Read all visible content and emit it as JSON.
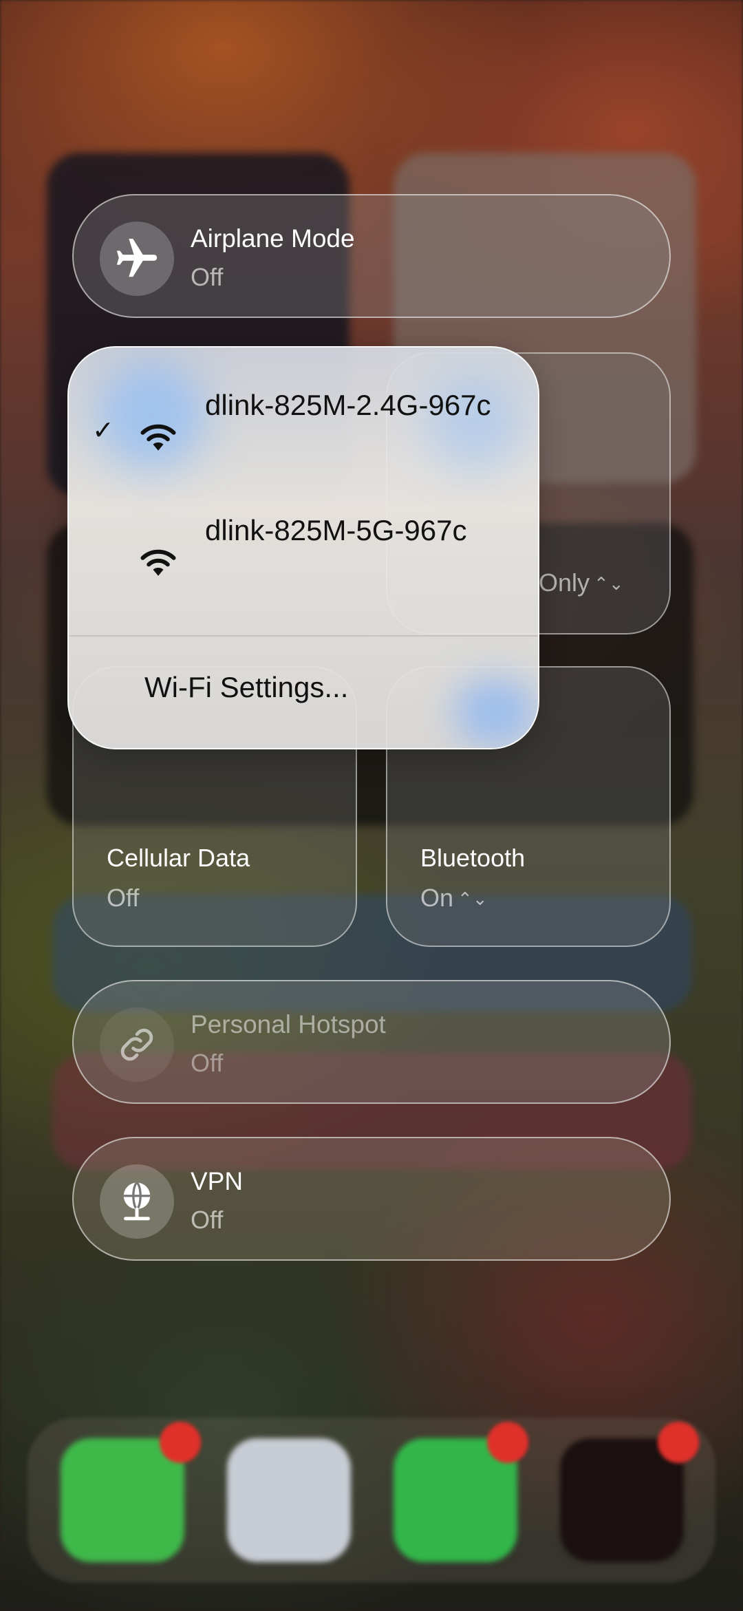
{
  "airplane": {
    "title": "Airplane Mode",
    "status": "Off"
  },
  "wifi_menu": {
    "networks": [
      {
        "name": "dlink-825M-2.4G-967c",
        "selected": true
      },
      {
        "name": "dlink-825M-5G-967c",
        "selected": false
      }
    ],
    "checkmark": "✓",
    "settings_label": "Wi-Fi Settings..."
  },
  "partial_tile": {
    "status": "Only"
  },
  "cellular": {
    "title": "Cellular Data",
    "status": "Off"
  },
  "bluetooth": {
    "title": "Bluetooth",
    "status": "On"
  },
  "hotspot": {
    "title": "Personal Hotspot",
    "status": "Off"
  },
  "vpn": {
    "title": "VPN",
    "status": "Off"
  },
  "icons": {
    "airplane": "airplane-icon",
    "wifi": "wifi-icon",
    "hotspot": "link-icon",
    "vpn": "globe-network-icon",
    "chevron": "chevron-up-down-icon"
  }
}
